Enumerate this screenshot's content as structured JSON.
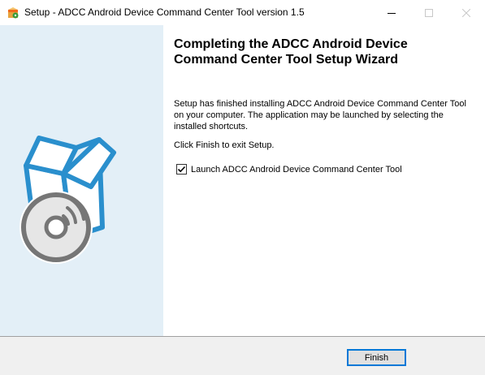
{
  "window": {
    "title": "Setup - ADCC Android Device Command Center Tool version 1.5",
    "icon": "setup-app-icon",
    "controls": [
      "minimize-icon",
      "maximize-icon",
      "close-icon"
    ]
  },
  "side_panel": {
    "illustration": "open-box-with-cd-icon",
    "background_color": "#e3eff7",
    "accent_color": "#2a8fcd"
  },
  "content": {
    "heading": "Completing the ADCC Android Device Command Center Tool Setup Wizard",
    "paragraph_1": "Setup has finished installing ADCC Android Device Command Center Tool on your computer. The application may be launched by selecting the installed shortcuts.",
    "paragraph_2": "Click Finish to exit Setup.",
    "launch_checkbox": {
      "label": "Launch ADCC Android Device Command Center Tool",
      "checked": true
    }
  },
  "footer": {
    "finish_label": "Finish",
    "button_focus_color": "#0078d7"
  }
}
